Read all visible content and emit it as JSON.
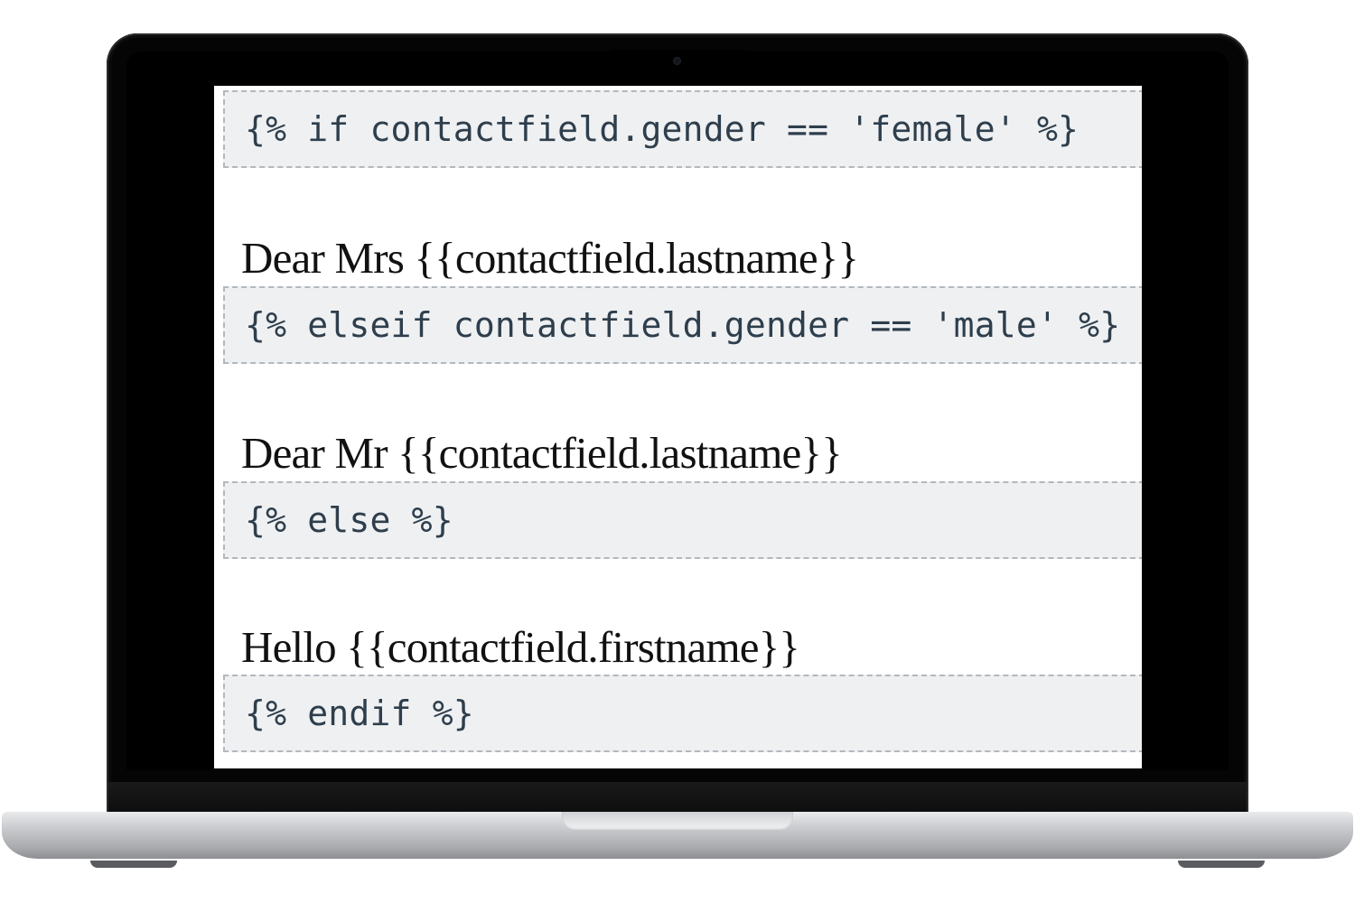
{
  "template": {
    "if_tag": "{% if contactfield.gender == 'female' %}",
    "female_greeting": "Dear Mrs {{contactfield.lastname}}",
    "elseif_tag": "{% elseif contactfield.gender == 'male' %}",
    "male_greeting": "Dear Mr {{contactfield.lastname}}",
    "else_tag": "{% else %}",
    "default_greeting": "Hello {{contactfield.firstname}}",
    "endif_tag": "{% endif %}"
  },
  "colors": {
    "code_background": "#eef0f2",
    "code_border": "#b3b8bd",
    "code_text": "#2e3e4c",
    "greeting_text": "#111111",
    "laptop_bezel": "#050505",
    "laptop_body": "#c9cbce"
  }
}
